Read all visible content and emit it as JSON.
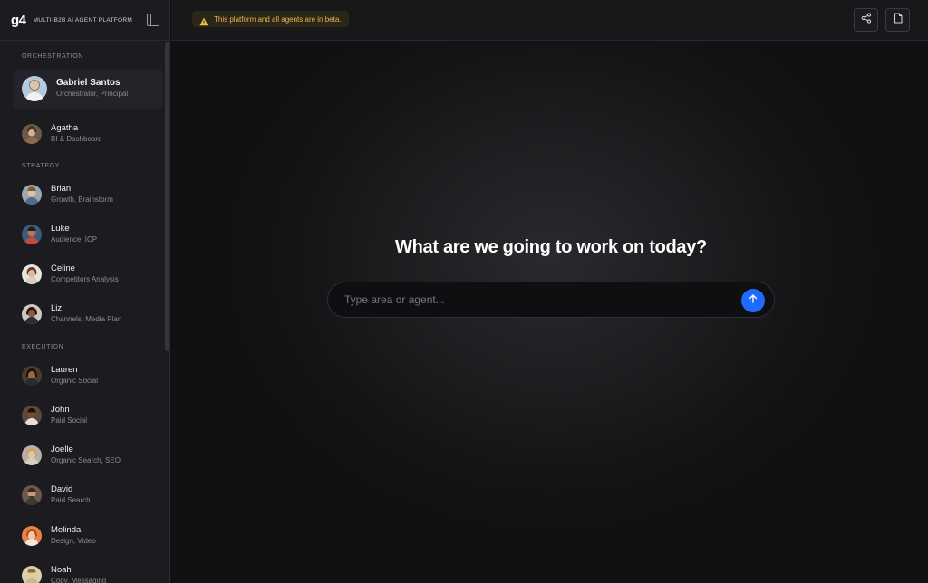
{
  "brand": {
    "logo": "g4",
    "name": "MULTI-B2B AI AGENT PLATFORM"
  },
  "sections": {
    "orchestration": "ORCHESTRATION",
    "strategy": "STRATEGY",
    "execution": "EXECUTION"
  },
  "agents": [
    {
      "name": "Gabriel Santos",
      "role": "Orchestrator, Principal"
    },
    {
      "name": "Agatha",
      "role": "BI & Dashboard"
    },
    {
      "name": "Brian",
      "role": "Growth, Brainstorm"
    },
    {
      "name": "Luke",
      "role": "Audience, ICP"
    },
    {
      "name": "Celine",
      "role": "Competitors Analysis"
    },
    {
      "name": "Liz",
      "role": "Channels, Media Plan"
    },
    {
      "name": "Lauren",
      "role": "Organic Social"
    },
    {
      "name": "John",
      "role": "Paid Social"
    },
    {
      "name": "Joelle",
      "role": "Organic Search, SEO"
    },
    {
      "name": "David",
      "role": "Paid Search"
    },
    {
      "name": "Melinda",
      "role": "Design, Video"
    },
    {
      "name": "Noah",
      "role": "Copy, Messaging"
    }
  ],
  "topbar": {
    "beta_notice": "This platform and all agents are in beta."
  },
  "main": {
    "headline": "What are we going to work on today?",
    "search_placeholder": "Type area or agent..."
  },
  "colors": {
    "accent": "#1f6bff",
    "warning": "#e8b84a"
  },
  "icons": [
    "sidebar-toggle-icon",
    "warning-icon",
    "share-icon",
    "document-icon",
    "arrow-up-icon"
  ]
}
